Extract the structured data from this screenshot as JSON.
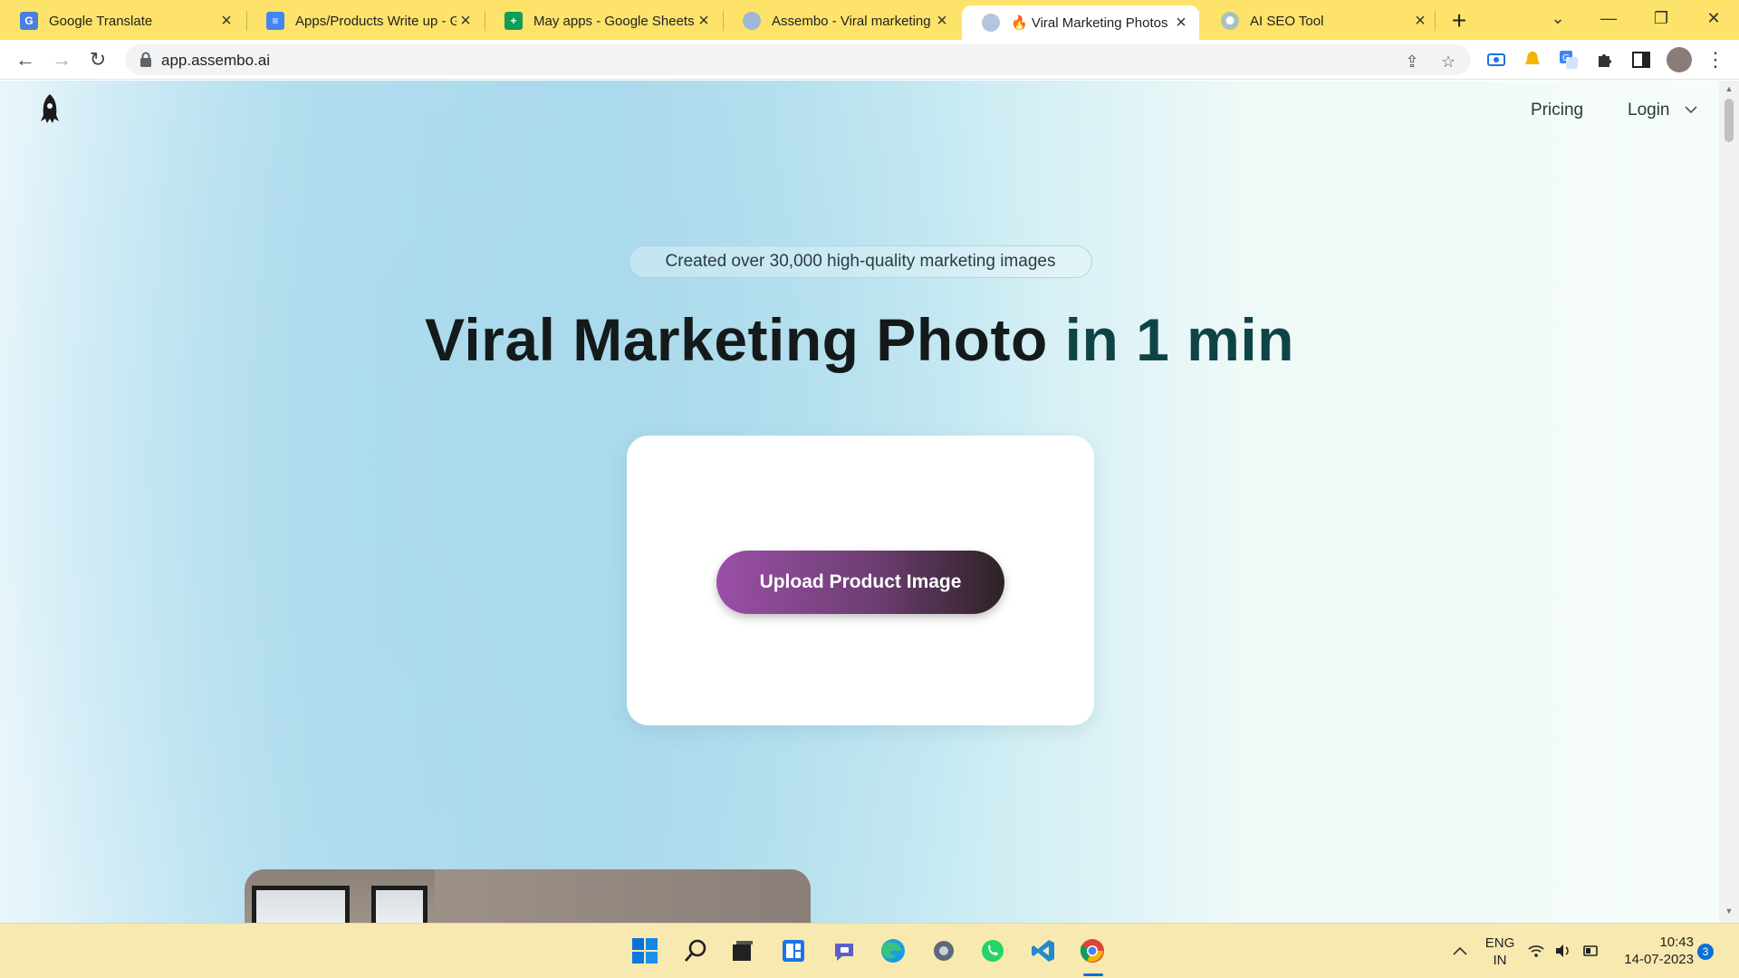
{
  "browser": {
    "tabs": [
      {
        "label": "Google Translate",
        "icon": "google-translate-icon",
        "color": "#4a7fe0",
        "active": false
      },
      {
        "label": "Apps/Products Write up - G",
        "icon": "google-docs-icon",
        "color": "#4285f4",
        "active": false
      },
      {
        "label": "May apps - Google Sheets",
        "icon": "google-sheets-icon",
        "color": "#0f9d58",
        "active": false
      },
      {
        "label": "Assembo - Viral marketing",
        "icon": "assembo-icon",
        "color": "#9fb6d6",
        "active": false
      },
      {
        "label": "🔥 Viral Marketing Photos |",
        "icon": "assembo-icon",
        "color": "#b4c6dd",
        "active": true
      },
      {
        "label": "AI SEO Tool",
        "icon": "openai-icon",
        "color": "#a7c4bc",
        "active": false
      }
    ],
    "new_tab_label": "+",
    "url": "app.assembo.ai"
  },
  "page": {
    "nav": {
      "pricing": "Pricing",
      "login": "Login"
    },
    "badge_text": "Created over 30,000 high-quality marketing images",
    "headline_part1": "Viral Marketing Photo",
    "headline_part2": " in 1 min",
    "upload_button": "Upload Product Image"
  },
  "system": {
    "language_line1": "ENG",
    "language_line2": "IN",
    "time": "10:43",
    "date": "14-07-2023",
    "notification_count": "3"
  },
  "colors": {
    "tab_strip": "#fde36a",
    "taskbar": "#f8e9b0",
    "headline_dark": "#141a1a",
    "headline_teal": "#0f4446",
    "button_start": "#9b4fa8",
    "button_end": "#2d2224"
  }
}
